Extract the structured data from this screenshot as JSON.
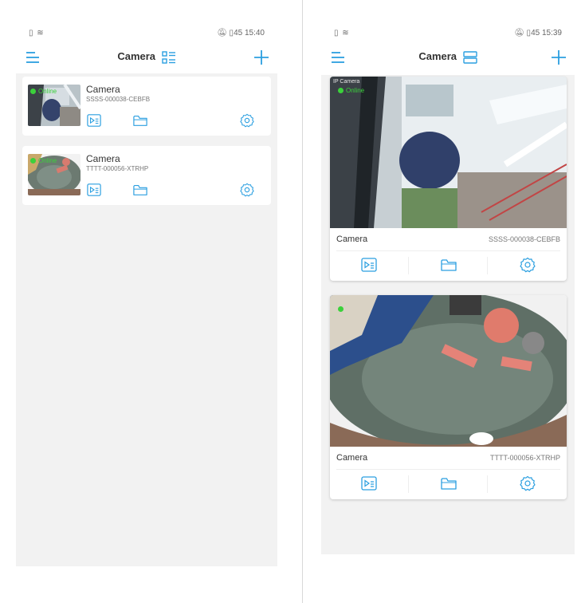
{
  "accent_color": "#2b9fe0",
  "online_color": "#3bd13b",
  "left_screen": {
    "status": {
      "time": "15:40",
      "battery": "45"
    },
    "app_bar": {
      "title": "Camera",
      "view_mode": "list"
    },
    "devices": [
      {
        "name": "Camera",
        "device_id": "SSSS-000038-CEBFB",
        "status_label": "Online",
        "icons": [
          "playback-icon",
          "folder-icon",
          "settings-icon"
        ]
      },
      {
        "name": "Camera",
        "device_id": "TTTT-000056-XTRHP",
        "status_label": "Online",
        "icons": [
          "playback-icon",
          "folder-icon",
          "settings-icon"
        ]
      }
    ]
  },
  "right_screen": {
    "status": {
      "time": "15:39",
      "battery": "45"
    },
    "app_bar": {
      "title": "Camera",
      "view_mode": "grid"
    },
    "devices": [
      {
        "name": "Camera",
        "device_id": "SSSS-000038-CEBFB",
        "status_label": "Online",
        "overlay_label": "IP Camera",
        "icons": [
          "playback-icon",
          "folder-icon",
          "settings-icon"
        ]
      },
      {
        "name": "Camera",
        "device_id": "TTTT-000056-XTRHP",
        "status_label": "",
        "icons": [
          "playback-icon",
          "folder-icon",
          "settings-icon"
        ]
      }
    ]
  }
}
